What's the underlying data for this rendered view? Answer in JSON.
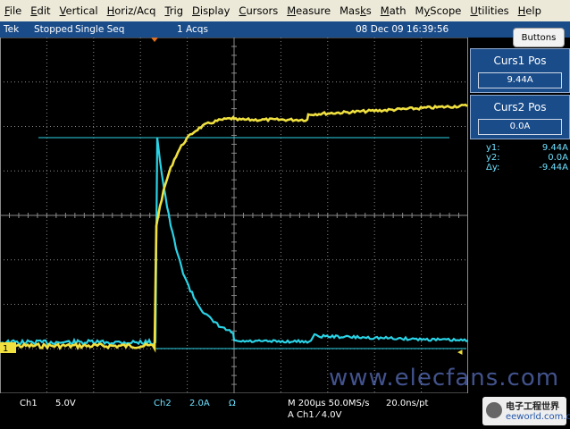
{
  "menu": [
    {
      "label": "File",
      "key": "F"
    },
    {
      "label": "Edit",
      "key": "E"
    },
    {
      "label": "Vertical",
      "key": "V"
    },
    {
      "label": "Horiz/Acq",
      "key": "H"
    },
    {
      "label": "Trig",
      "key": "T"
    },
    {
      "label": "Display",
      "key": "D"
    },
    {
      "label": "Cursors",
      "key": "C"
    },
    {
      "label": "Measure",
      "key": "M"
    },
    {
      "label": "Masks",
      "key": "k"
    },
    {
      "label": "Math",
      "key": "M"
    },
    {
      "label": "MyScope",
      "key": "y"
    },
    {
      "label": "Utilities",
      "key": "U"
    },
    {
      "label": "Help",
      "key": "H"
    }
  ],
  "status": {
    "brand": "Tek",
    "state": "Stopped",
    "mode": "Single Seq",
    "acqs": "1 Acqs",
    "datetime": "08 Dec 09 16:39:56",
    "buttons_label": "Buttons"
  },
  "cursors": {
    "curs1_title": "Curs1 Pos",
    "curs1_value": "9.44A",
    "curs2_title": "Curs2 Pos",
    "curs2_value": "0.0A",
    "y1_label": "y1:",
    "y1_value": "9.44A",
    "y2_label": "y2:",
    "y2_value": "0.0A",
    "dy_label": "Δy:",
    "dy_value": "-9.44A"
  },
  "bottom": {
    "ch1": "Ch1",
    "ch1_scale": "5.0V",
    "ch2": "Ch2",
    "ch2_scale": "2.0A",
    "ch2_unit": "Ω",
    "timebase": "M 200µs 50.0MS/s",
    "resolution": "20.0ns/pt",
    "trigger": "A  Ch1  ⁄  4.0V"
  },
  "marker_ch1": "1",
  "watermark": "www.elecfans.com",
  "logo": {
    "line1": "电子工程世界",
    "line2": "eeworld.com.cn"
  },
  "colors": {
    "ch1": "#f0e040",
    "ch2": "#2ad3e6",
    "grid": "#8a8a8a",
    "panel": "#1a4c8a"
  }
}
